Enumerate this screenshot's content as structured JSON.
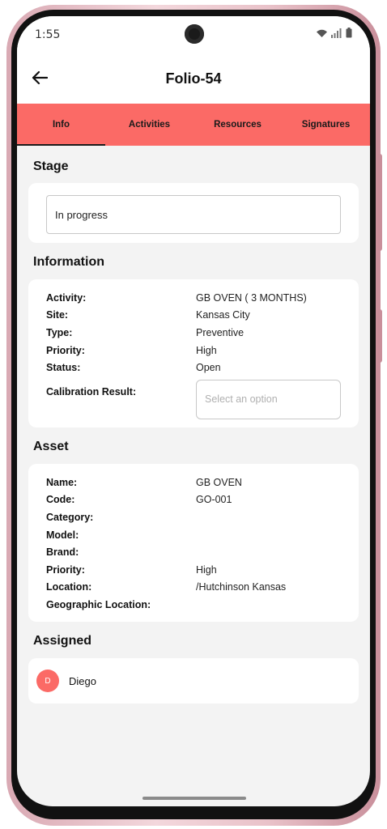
{
  "status_bar": {
    "time": "1:55",
    "icons": [
      "wifi-icon",
      "signal-icon",
      "battery-icon"
    ]
  },
  "header": {
    "title": "Folio-54",
    "back_icon": "arrow-left-icon"
  },
  "tabs": [
    {
      "label": "Info",
      "active": true
    },
    {
      "label": "Activities",
      "active": false
    },
    {
      "label": "Resources",
      "active": false
    },
    {
      "label": "Signatures",
      "active": false
    }
  ],
  "stage": {
    "title": "Stage",
    "value": "In progress"
  },
  "information": {
    "title": "Information",
    "rows": [
      {
        "label": "Activity:",
        "value": "GB OVEN ( 3 MONTHS)"
      },
      {
        "label": "Site:",
        "value": "Kansas City"
      },
      {
        "label": "Type:",
        "value": "Preventive"
      },
      {
        "label": "Priority:",
        "value": "High"
      },
      {
        "label": "Status:",
        "value": "Open"
      }
    ],
    "calibration_label": "Calibration Result:",
    "calibration_placeholder": "Select an option"
  },
  "asset": {
    "title": "Asset",
    "rows": [
      {
        "label": "Name:",
        "value": "GB OVEN"
      },
      {
        "label": "Code:",
        "value": "GO-001"
      },
      {
        "label": "Category:",
        "value": ""
      },
      {
        "label": "Model:",
        "value": ""
      },
      {
        "label": "Brand:",
        "value": ""
      },
      {
        "label": "Priority:",
        "value": "High"
      },
      {
        "label": "Location:",
        "value": "/Hutchinson Kansas"
      },
      {
        "label": "Geographic Location:",
        "value": ""
      }
    ]
  },
  "assigned": {
    "title": "Assigned",
    "people": [
      {
        "initial": "D",
        "name": "Diego"
      }
    ]
  },
  "colors": {
    "accent": "#fb6a66",
    "background": "#f3f3f3",
    "card": "#ffffff"
  }
}
